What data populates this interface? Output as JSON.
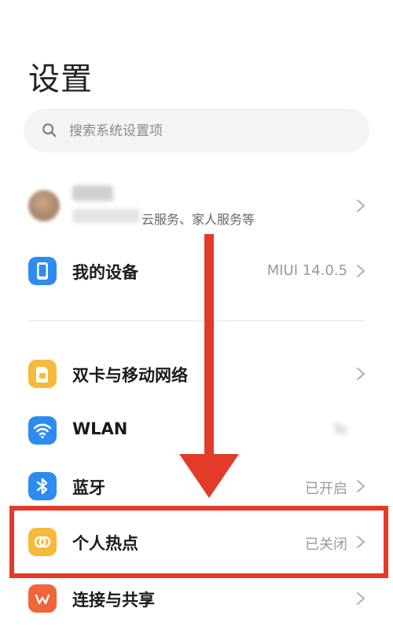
{
  "page": {
    "title": "设置"
  },
  "search": {
    "placeholder": "搜索系统设置项",
    "icon": "search-icon"
  },
  "account": {
    "subtitle": "云服务、家人服务等"
  },
  "items": [
    {
      "id": "my-device",
      "label": "我的设备",
      "value": "MIUI 14.0.5",
      "icon": "phone-icon",
      "color": "#2e8bf0"
    },
    {
      "id": "dual-sim",
      "label": "双卡与移动网络",
      "value": "",
      "icon": "sim-card-icon",
      "color": "#f6b93b"
    },
    {
      "id": "wlan",
      "label": "WLAN",
      "value": "Te",
      "icon": "wifi-icon",
      "color": "#2e8bf0"
    },
    {
      "id": "bluetooth",
      "label": "蓝牙",
      "value": "已开启",
      "icon": "bluetooth-icon",
      "color": "#2e8bf0"
    },
    {
      "id": "hotspot",
      "label": "个人热点",
      "value": "已关闭",
      "icon": "hotspot-icon",
      "color": "#f6b93b"
    },
    {
      "id": "connection-share",
      "label": "连接与共享",
      "value": "",
      "icon": "share-icon",
      "color": "#f0653a"
    }
  ],
  "annotation": {
    "color": "#e43a2a",
    "highlighted_item": "个人热点"
  }
}
